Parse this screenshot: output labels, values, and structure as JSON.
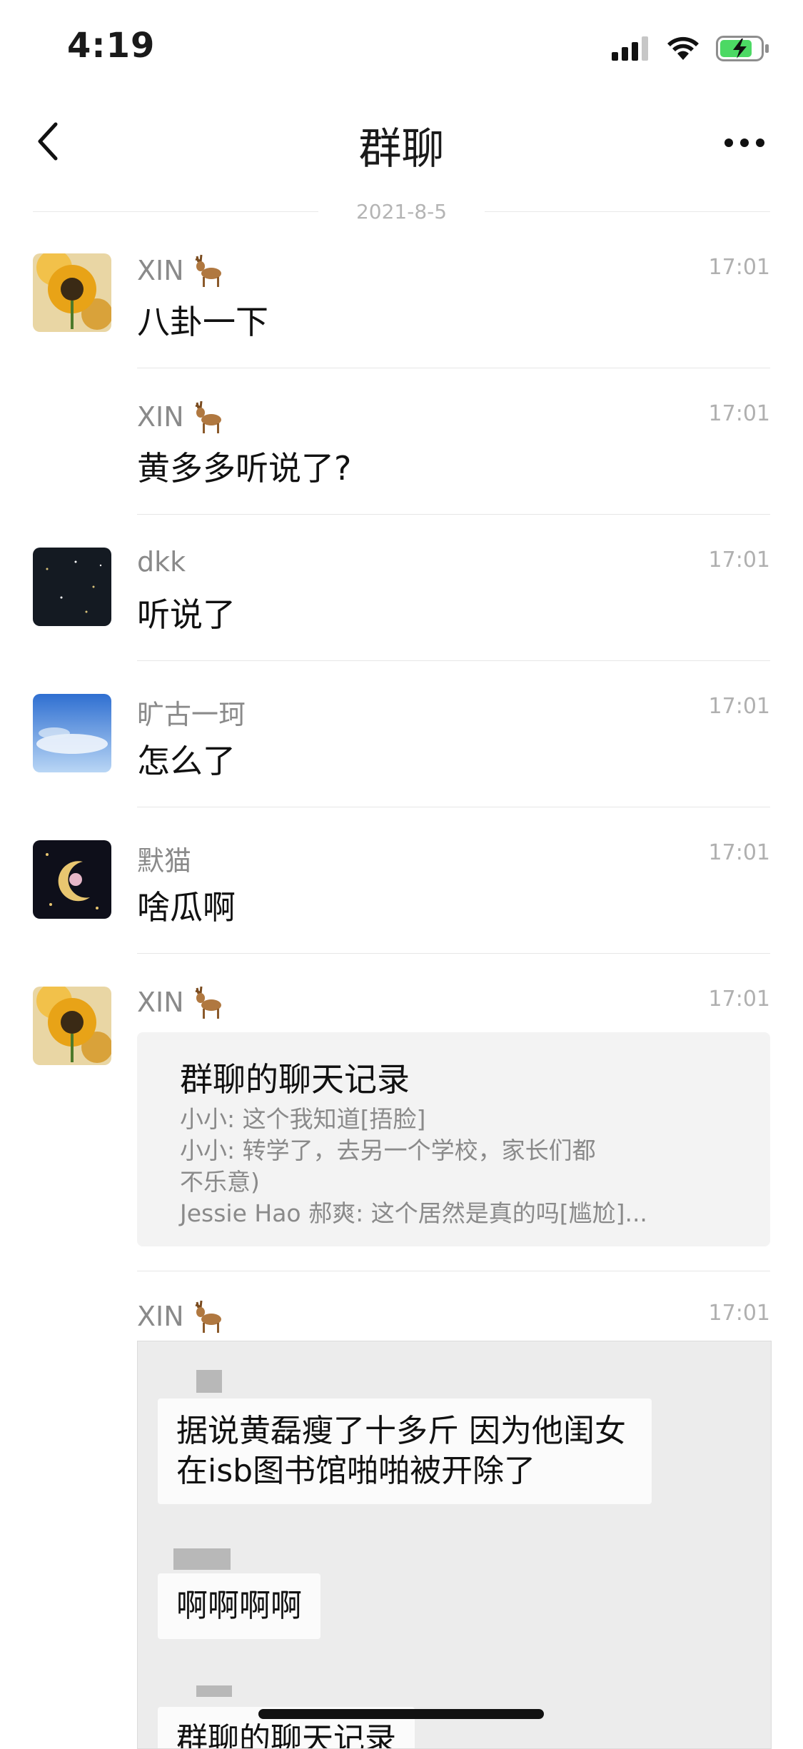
{
  "status_bar": {
    "time": "4:19"
  },
  "nav": {
    "title": "群聊"
  },
  "date_divider": "2021-8-5",
  "messages": [
    {
      "sender": "XIN",
      "text": "八卦一下",
      "time": "17:01"
    },
    {
      "sender": "XIN",
      "text": "黄多多听说了?",
      "time": "17:01"
    },
    {
      "sender": "dkk",
      "text": "听说了",
      "time": "17:01"
    },
    {
      "sender": "旷古一珂",
      "text": "怎么了",
      "time": "17:01"
    },
    {
      "sender": "默猫",
      "text": "啥瓜啊",
      "time": "17:01"
    }
  ],
  "record_message": {
    "sender": "XIN",
    "time": "17:01",
    "title": "群聊的聊天记录",
    "lines": [
      "小小: 这个我知道[捂脸]",
      "小小: 转学了，去另一个学校，家长们都",
      "不乐意)",
      "Jessie Hao 郝爽: 这个居然是真的吗[尴尬]..."
    ]
  },
  "image_message": {
    "sender": "XIN",
    "time": "17:01",
    "bubbles": [
      "据说黄磊瘦了十多斤 因为他闺女",
      "在isb图书馆啪啪被开除了",
      "啊啊啊啊",
      "群聊的聊天记录"
    ]
  },
  "colors": {
    "background": "#ffffff",
    "muted_text": "#8a8a8a",
    "battery_green": "#4cd964"
  }
}
